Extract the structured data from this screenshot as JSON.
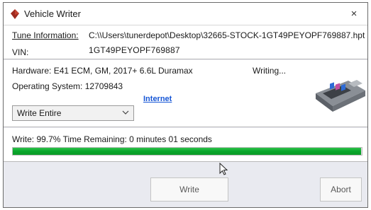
{
  "window": {
    "title": "Vehicle Writer",
    "close_symbol": "×",
    "app_icon": "car-icon",
    "accent_color": "#9e2a1f"
  },
  "info": {
    "tune_label": "Tune Information:",
    "tune_value": "C:\\\\Users\\tunerdepot\\Desktop\\32665-STOCK-1GT49PEYOPF769887.hpt",
    "vin_label": "VIN:",
    "vin_value": "1GT49PEYOPF769887"
  },
  "hardware": {
    "hardware_text": "Hardware: E41 ECM, GM, 2017+ 6.6L Duramax",
    "os_text": "Operating System: 12709843",
    "status_text": "Writing...",
    "internet_link": "Internet",
    "write_mode_selected": "Write Entire",
    "ecm_image": "ecm-module-image"
  },
  "progress": {
    "status_text": "Write: 99.7% Time Remaining: 0 minutes 01 seconds",
    "percent": 99.7,
    "fill_color": "#0aa82c"
  },
  "buttons": {
    "write_label": "Write",
    "abort_label": "Abort"
  }
}
